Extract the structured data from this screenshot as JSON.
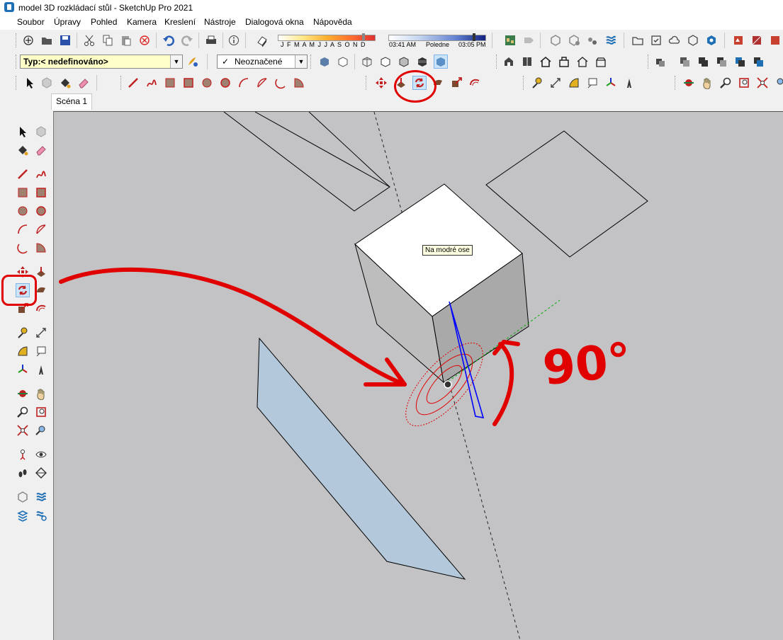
{
  "window": {
    "title": "model 3D rozkládací stůl - SketchUp Pro 2021"
  },
  "menu": {
    "items": [
      "Soubor",
      "Úpravy",
      "Pohled",
      "Kamera",
      "Kreslení",
      "Nástroje",
      "Dialogová okna",
      "Nápověda"
    ]
  },
  "shadows": {
    "months": "J F M A M J J A S O N D",
    "time_start": "03:41 AM",
    "time_mid": "Poledne",
    "time_end": "03:05 PM"
  },
  "toolbar": {
    "type_combo": "Typ:< nedefinováno>",
    "tag_combo_check": "✓",
    "tag_combo_value": "Neoznačené"
  },
  "scenes": {
    "tab": "Scéna 1"
  },
  "viewport": {
    "tooltip": "Na modré ose",
    "annotation": "90°"
  },
  "colors": {
    "annotation": "#e00000",
    "viewport_bg": "#c3c3c6",
    "blue_axis": "#0000ff",
    "green_axis": "#00aa00",
    "tooltip_bg": "#ffffe1",
    "plane_fill": "#b3c9db"
  },
  "icons": {
    "rotate": "rotate-icon",
    "move": "move-icon",
    "pushpull": "push-pull-icon",
    "select": "select-arrow-icon"
  }
}
